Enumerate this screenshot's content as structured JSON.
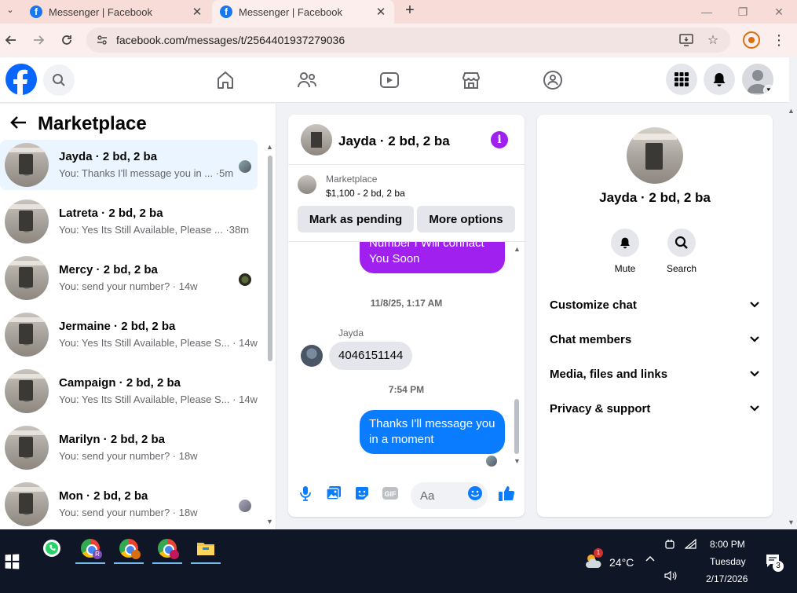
{
  "browser": {
    "tabs": [
      {
        "title": "Messenger | Facebook",
        "close": "✕"
      },
      {
        "title": "Messenger | Facebook",
        "close": "✕"
      }
    ],
    "new_tab": "+",
    "url": "facebook.com/messages/t/2564401937279036"
  },
  "sidebar": {
    "title": "Marketplace",
    "conversations": [
      {
        "name": "Jayda · 2 bd, 2 ba",
        "preview": "You: Thanks I'll message you in ... ·5m",
        "active": true
      },
      {
        "name": "Latreta · 2 bd, 2 ba",
        "preview": "You: Yes Its Still Available, Please ... ·38m"
      },
      {
        "name": "Mercy · 2 bd, 2 ba",
        "preview": "You: send your number? · 14w"
      },
      {
        "name": "Jermaine · 2 bd, 2 ba",
        "preview": "You: Yes Its Still Available, Please S... · 14w"
      },
      {
        "name": "Campaign · 2 bd, 2 ba",
        "preview": "You: Yes Its Still Available, Please S... · 14w"
      },
      {
        "name": "Marilyn · 2 bd, 2 ba",
        "preview": "You: send your number? · 18w"
      },
      {
        "name": "Mon · 2 bd, 2 ba",
        "preview": "You: send your number? · 18w"
      }
    ]
  },
  "chat": {
    "title": "Jayda · 2 bd, 2 ba",
    "marketplace_label": "Marketplace",
    "listing": "$1,100 - 2 bd, 2 ba",
    "mark_pending": "Mark as pending",
    "more_options": "More options",
    "messages": {
      "out1": "Number I Will connact You Soon",
      "ts1": "11/8/25, 1:17 AM",
      "sender": "Jayda",
      "in1": "4046151144",
      "ts2": "7:54 PM",
      "out2": "Thanks I'll message you in a moment"
    },
    "composer_placeholder": "Aa"
  },
  "info_panel": {
    "name": "Jayda · 2 bd, 2 ba",
    "mute": "Mute",
    "search": "Search",
    "rows": [
      "Customize chat",
      "Chat members",
      "Media, files and links",
      "Privacy & support"
    ]
  },
  "taskbar": {
    "temperature": "24°C",
    "time": "8:00 PM",
    "day": "Tuesday",
    "date": "2/17/2026",
    "notifications": "3",
    "weather_badge": "1"
  },
  "colors": {
    "fb_blue": "#0866ff",
    "outgoing_blue": "#0a7cff",
    "purple": "#a020f0"
  }
}
